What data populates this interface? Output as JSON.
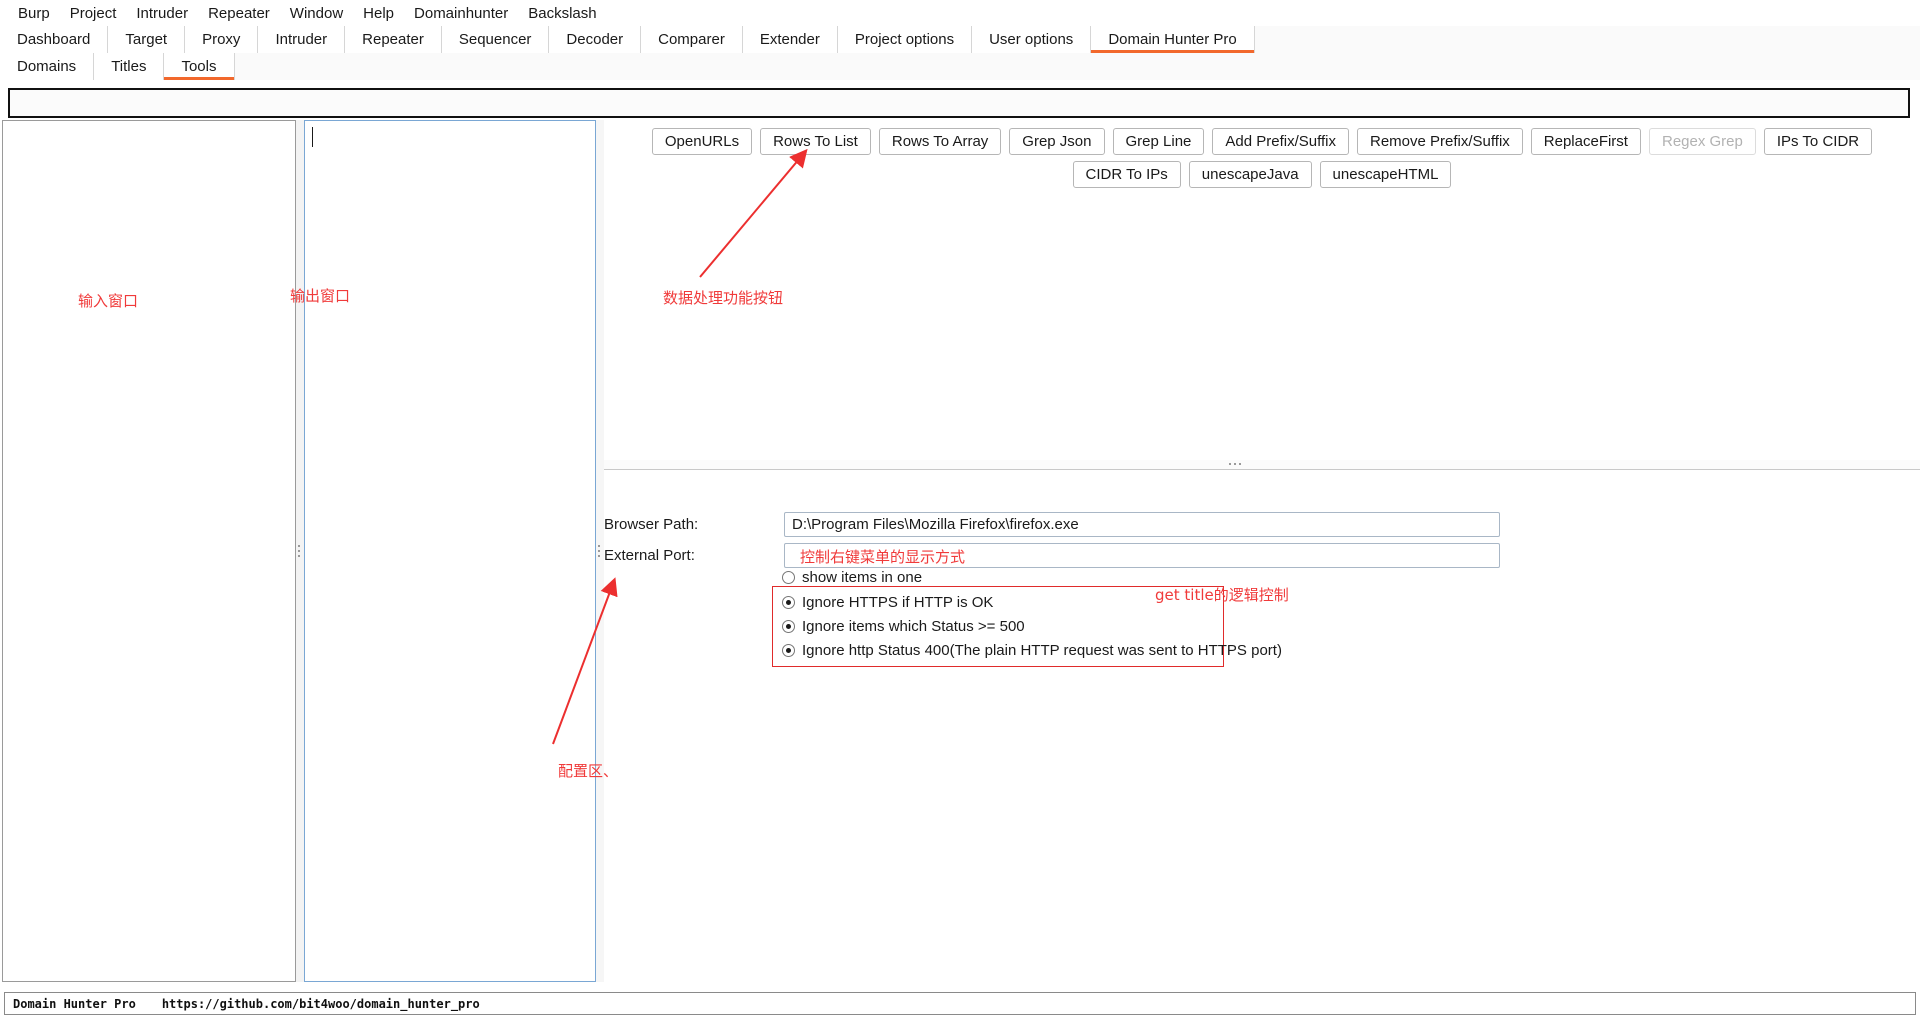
{
  "colors": {
    "accent": "#f2682c",
    "annotation": "#f03a3a",
    "focus_border": "#7aa7d4"
  },
  "menubar": {
    "items": [
      {
        "label": "Burp"
      },
      {
        "label": "Project"
      },
      {
        "label": "Intruder"
      },
      {
        "label": "Repeater"
      },
      {
        "label": "Window"
      },
      {
        "label": "Help"
      },
      {
        "label": "Domainhunter"
      },
      {
        "label": "Backslash"
      }
    ]
  },
  "main_tabs": {
    "active": "Domain Hunter Pro",
    "items": [
      {
        "label": "Dashboard",
        "active": false
      },
      {
        "label": "Target",
        "active": false
      },
      {
        "label": "Proxy",
        "active": false
      },
      {
        "label": "Intruder",
        "active": false
      },
      {
        "label": "Repeater",
        "active": false
      },
      {
        "label": "Sequencer",
        "active": false
      },
      {
        "label": "Decoder",
        "active": false
      },
      {
        "label": "Comparer",
        "active": false
      },
      {
        "label": "Extender",
        "active": false
      },
      {
        "label": "Project options",
        "active": false
      },
      {
        "label": "User options",
        "active": false
      },
      {
        "label": "Domain Hunter Pro",
        "active": true
      }
    ]
  },
  "sub_tabs": {
    "active": "Tools",
    "items": [
      {
        "label": "Domains",
        "active": false
      },
      {
        "label": "Titles",
        "active": false
      },
      {
        "label": "Tools",
        "active": true
      }
    ]
  },
  "topbar": {
    "value": "",
    "placeholder": ""
  },
  "panels": {
    "input": {
      "value": "",
      "placeholder": ""
    },
    "output": {
      "value": "",
      "placeholder": ""
    }
  },
  "tool_buttons": {
    "row1": [
      {
        "label": "OpenURLs",
        "disabled": false
      },
      {
        "label": "Rows To List",
        "disabled": false
      },
      {
        "label": "Rows To Array",
        "disabled": false
      },
      {
        "label": "Grep Json",
        "disabled": false
      },
      {
        "label": "Grep Line",
        "disabled": false
      },
      {
        "label": "Add Prefix/Suffix",
        "disabled": false
      },
      {
        "label": "Remove Prefix/Suffix",
        "disabled": false
      },
      {
        "label": "ReplaceFirst",
        "disabled": false
      },
      {
        "label": "Regex Grep",
        "disabled": true
      },
      {
        "label": "IPs To CIDR",
        "disabled": false
      }
    ],
    "row2": [
      {
        "label": "CIDR To IPs",
        "disabled": false
      },
      {
        "label": "unescapeJava",
        "disabled": false
      },
      {
        "label": "unescapeHTML",
        "disabled": false
      }
    ]
  },
  "config": {
    "browser_path": {
      "label": "Browser Path:",
      "value": "D:\\Program Files\\Mozilla Firefox\\firefox.exe",
      "placeholder": ""
    },
    "external_port": {
      "label": "External Port:",
      "value": "",
      "placeholder": ""
    },
    "show_items_in_one": {
      "label": "show items in one",
      "selected": false
    },
    "ignore_options": [
      {
        "label": "Ignore HTTPS if HTTP is OK",
        "selected": true
      },
      {
        "label": "Ignore items which Status >= 500",
        "selected": true
      },
      {
        "label": "Ignore http Status 400(The plain HTTP request was sent to HTTPS port)",
        "selected": true
      }
    ]
  },
  "annotations": {
    "input_window": "输入窗口",
    "output_window": "输出窗口",
    "data_buttons": "数据处理功能按钮",
    "context_menu_display": "控制右键菜单的显示方式",
    "get_title_logic": "get title的逻辑控制",
    "config_area": "配置区、"
  },
  "statusbar": {
    "name": "Domain Hunter Pro",
    "url": "https://github.com/bit4woo/domain_hunter_pro"
  }
}
